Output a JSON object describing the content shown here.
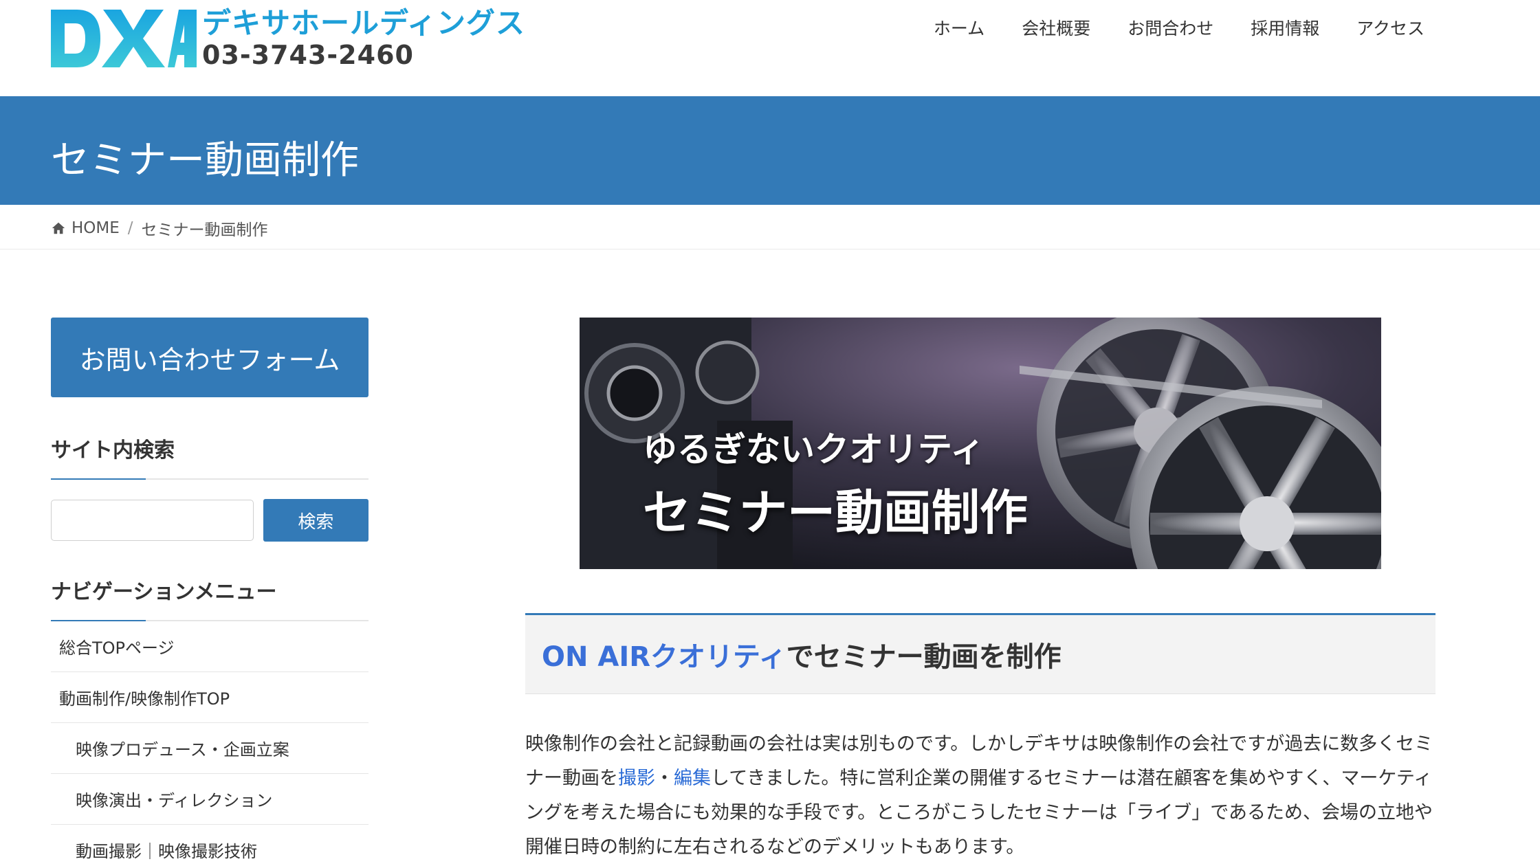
{
  "header": {
    "logo_name": "デキサホールディングス",
    "logo_phone": "03-3743-2460",
    "nav": [
      "ホーム",
      "会社概要",
      "お問合わせ",
      "採用情報",
      "アクセス"
    ]
  },
  "page": {
    "title": "セミナー動画制作"
  },
  "breadcrumb": {
    "home": "HOME",
    "separator": "/",
    "current": "セミナー動画制作"
  },
  "sidebar": {
    "contact_button": "お問い合わせフォーム",
    "search_title": "サイト内検索",
    "search_button": "検索",
    "search_value": "",
    "nav_title": "ナビゲーションメニュー",
    "nav_items": [
      "総合TOPページ",
      "動画制作/映像制作TOP",
      "映像プロデュース・企画立案",
      "映像演出・ディレクション",
      "動画撮影｜映像撮影技術"
    ]
  },
  "hero": {
    "subtitle": "ゆるぎないクオリティ",
    "title": "セミナー動画制作"
  },
  "section": {
    "heading_highlight": "ON AIRクオリティ",
    "heading_rest": "でセミナー動画を制作"
  },
  "body": {
    "p1_a": "映像制作の会社と記録動画の会社は実は別ものです。しかしデキサは映像制作の会社ですが過去に数多くセミナー動画を",
    "link_shoot": "撮影",
    "dot": "・",
    "link_edit": "編集",
    "p1_b": "してきました。特に営利企業の開催するセミナーは潜在顧客を集めやすく、マーケティングを考えた場合にも効果的な手段です。ところがこうしたセミナーは「ライブ」であるため、会場の立地や開催日時の制約に左右されるなどのデメリットもあります。"
  },
  "colors": {
    "brand_blue": "#337ab7",
    "logo_cyan": "#1e9fd8",
    "link_blue": "#2a6bd6"
  }
}
